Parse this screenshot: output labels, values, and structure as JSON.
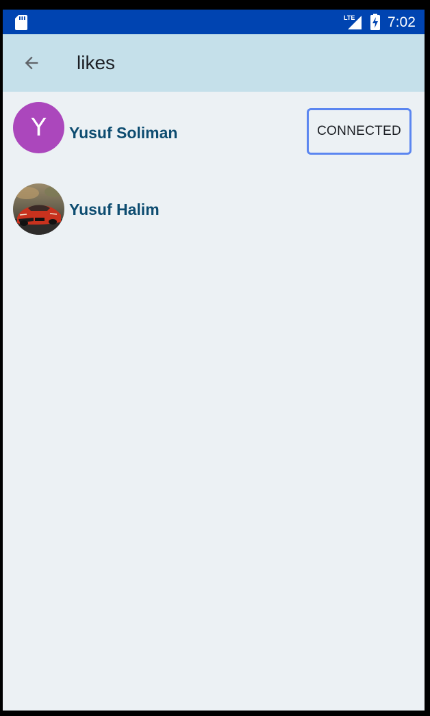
{
  "status_bar": {
    "time": "7:02",
    "network_label": "LTE",
    "icons": [
      "sd-card-icon",
      "lte-signal-icon",
      "battery-charging-icon"
    ]
  },
  "app_bar": {
    "title": "likes",
    "back_icon": "arrow-back-icon"
  },
  "users": [
    {
      "name": "Yusuf Soliman",
      "avatar_letter": "Y",
      "avatar_color": "#ab47bc",
      "action_label": "CONNECTED"
    },
    {
      "name": "Yusuf Halim",
      "avatar_image": "red-sports-car-photo"
    }
  ],
  "colors": {
    "status_bar": "#0044b1",
    "app_bar": "#c5e0ea",
    "background": "#ecf1f4",
    "name_text": "#0d4c70",
    "button_border": "#5b86f0"
  }
}
